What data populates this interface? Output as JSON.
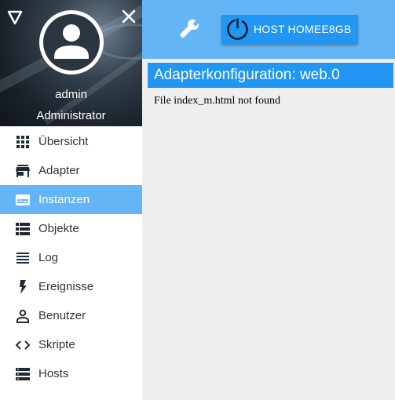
{
  "user": {
    "name": "admin",
    "role": "Administrator"
  },
  "nav": {
    "items": [
      {
        "label": "Übersicht",
        "icon": "apps-grid-icon",
        "active": false
      },
      {
        "label": "Adapter",
        "icon": "store-icon",
        "active": false
      },
      {
        "label": "Instanzen",
        "icon": "subtitles-icon",
        "active": true
      },
      {
        "label": "Objekte",
        "icon": "list-icon",
        "active": false
      },
      {
        "label": "Log",
        "icon": "lines-icon",
        "active": false
      },
      {
        "label": "Ereignisse",
        "icon": "flash-icon",
        "active": false
      },
      {
        "label": "Benutzer",
        "icon": "person-icon",
        "active": false
      },
      {
        "label": "Skripte",
        "icon": "code-icon",
        "active": false
      },
      {
        "label": "Hosts",
        "icon": "storage-icon",
        "active": false
      }
    ]
  },
  "topbar": {
    "host_label": "HOST HOMEE8GB"
  },
  "content": {
    "title": "Adapterkonfiguration: web.0",
    "message": "File index_m.html not found"
  },
  "colors": {
    "accent": "#2196f3",
    "accent_light": "#64b5f6",
    "background": "#eeeeee"
  }
}
